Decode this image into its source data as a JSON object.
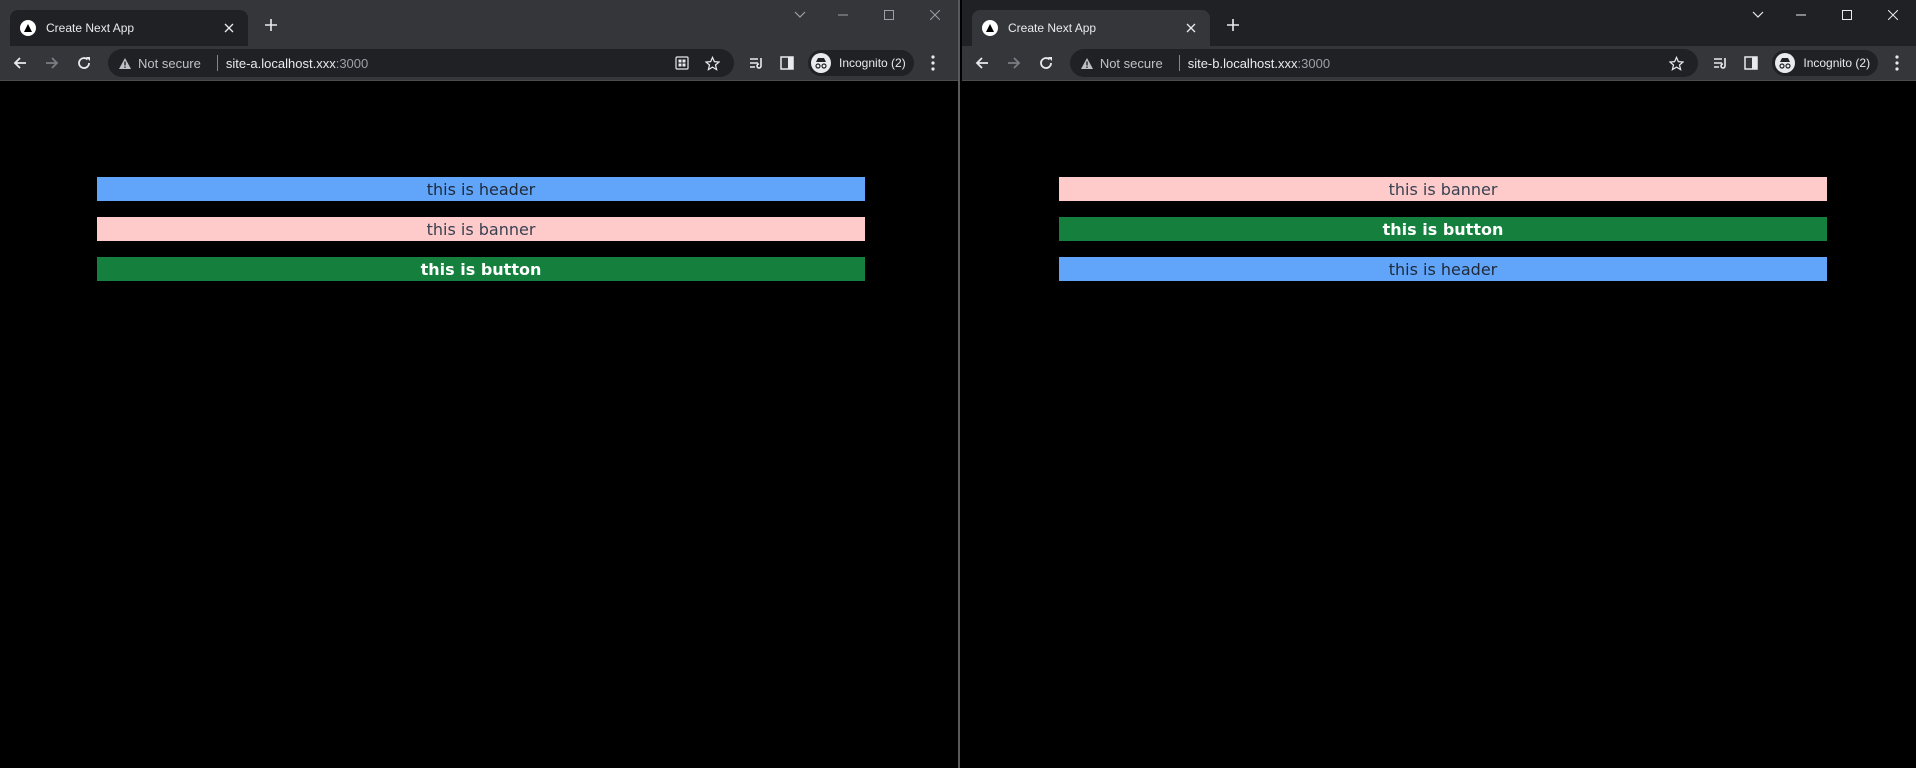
{
  "windows": [
    {
      "tab_title": "Create Next App",
      "not_secure_label": "Not secure",
      "url_host": "site-a.localhost.xxx",
      "url_port": ":3000",
      "incognito_label": "Incognito (2)",
      "bars": [
        "this is header",
        "this is banner",
        "this is button"
      ]
    },
    {
      "tab_title": "Create Next App",
      "not_secure_label": "Not secure",
      "url_host": "site-b.localhost.xxx",
      "url_port": ":3000",
      "incognito_label": "Incognito (2)",
      "bars": [
        "this is banner",
        "this is button",
        "this is header"
      ]
    }
  ],
  "colors": {
    "header": "#60a5fa",
    "banner": "#fecaca",
    "button": "#15803d",
    "chrome_frame": "#202124",
    "chrome_toolbar": "#35363a"
  },
  "icons": [
    "nextjs-favicon-icon",
    "close-icon",
    "plus-icon",
    "chevron-down-icon",
    "minimize-icon",
    "maximize-icon",
    "back-icon",
    "forward-icon",
    "reload-icon",
    "warning-icon",
    "install-app-icon",
    "star-icon",
    "reading-list-icon",
    "side-panel-icon",
    "incognito-icon",
    "kebab-menu-icon"
  ]
}
